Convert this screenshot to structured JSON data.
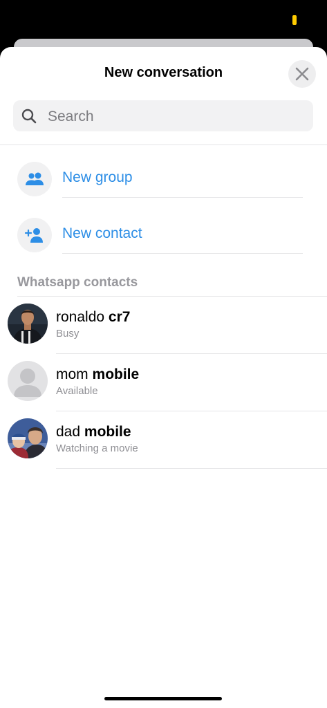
{
  "sheet": {
    "title": "New conversation",
    "close_icon": "close-icon"
  },
  "search": {
    "placeholder": "Search",
    "value": "",
    "icon": "search-icon"
  },
  "actions": [
    {
      "label": "New group",
      "icon": "group-icon"
    },
    {
      "label": "New contact",
      "icon": "add-contact-icon"
    }
  ],
  "section": {
    "title": "Whatsapp contacts"
  },
  "contacts": [
    {
      "first": "ronaldo",
      "last": "cr7",
      "status": "Busy",
      "avatar": "photo"
    },
    {
      "first": "mom",
      "last": "mobile",
      "status": "Available",
      "avatar": "placeholder"
    },
    {
      "first": "dad",
      "last": "mobile",
      "status": "Watching a movie",
      "avatar": "photo"
    }
  ],
  "colors": {
    "accent": "#2d8ee6",
    "secondary_text": "#8e8e93",
    "battery": "#ffcc00"
  }
}
